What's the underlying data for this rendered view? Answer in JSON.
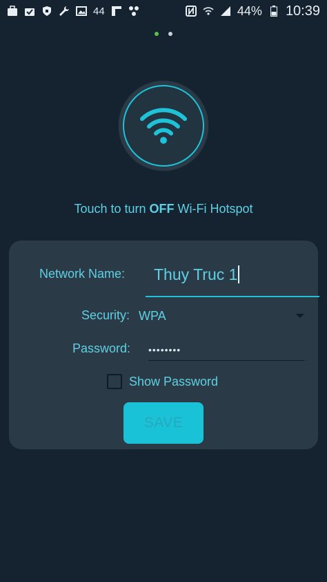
{
  "status_bar": {
    "notification_count": "44",
    "battery_percent": "44%",
    "time": "10:39",
    "icons": [
      "briefcase-icon",
      "briefcase-check-icon",
      "shield-icon",
      "wrench-icon",
      "image-icon",
      "flipboard-icon",
      "network-icon",
      "nfc-icon",
      "wifi-signal-icon",
      "cell-signal-icon",
      "battery-icon"
    ]
  },
  "pager": {
    "pages": 2,
    "active": 0
  },
  "hotspot": {
    "hint_prefix": "Touch to turn ",
    "hint_state": "OFF",
    "hint_suffix": " Wi-Fi Hotspot"
  },
  "form": {
    "network_name_label": "Network Name:",
    "network_name_value": "Thuy Truc 1",
    "security_label": "Security:",
    "security_value": "WPA",
    "password_label": "Password:",
    "password_mask": "••••••••",
    "show_password_label": "Show Password",
    "show_password_checked": false,
    "save_label": "SAVE"
  },
  "colors": {
    "background": "#14232f",
    "card": "#2a3b47",
    "accent": "#1ec3d8",
    "text": "#5fd0e3",
    "dot_active": "#5bc24a"
  }
}
